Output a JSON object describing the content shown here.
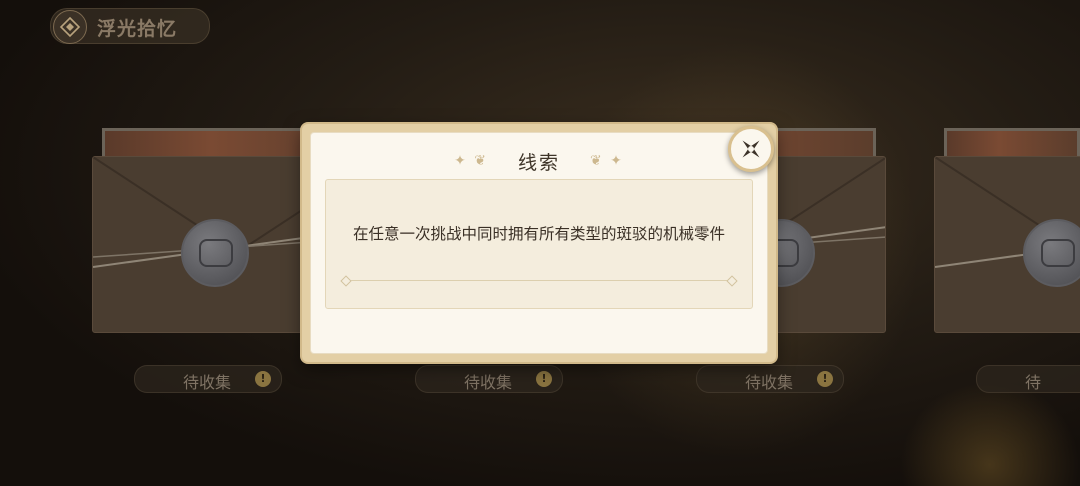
{
  "header": {
    "title": "浮光拾忆",
    "icon": "compass-diamond-icon"
  },
  "cards": [
    {
      "status": "待收集",
      "badge": "!"
    },
    {
      "status": "待收集",
      "badge": "!"
    },
    {
      "status": "待收集",
      "badge": "!"
    },
    {
      "status": "待",
      "badge": ""
    }
  ],
  "modal": {
    "title": "线索",
    "clue": "在任意一次挑战中同时拥有所有类型的斑驳的机械零件",
    "close_icon": "close-icon"
  }
}
